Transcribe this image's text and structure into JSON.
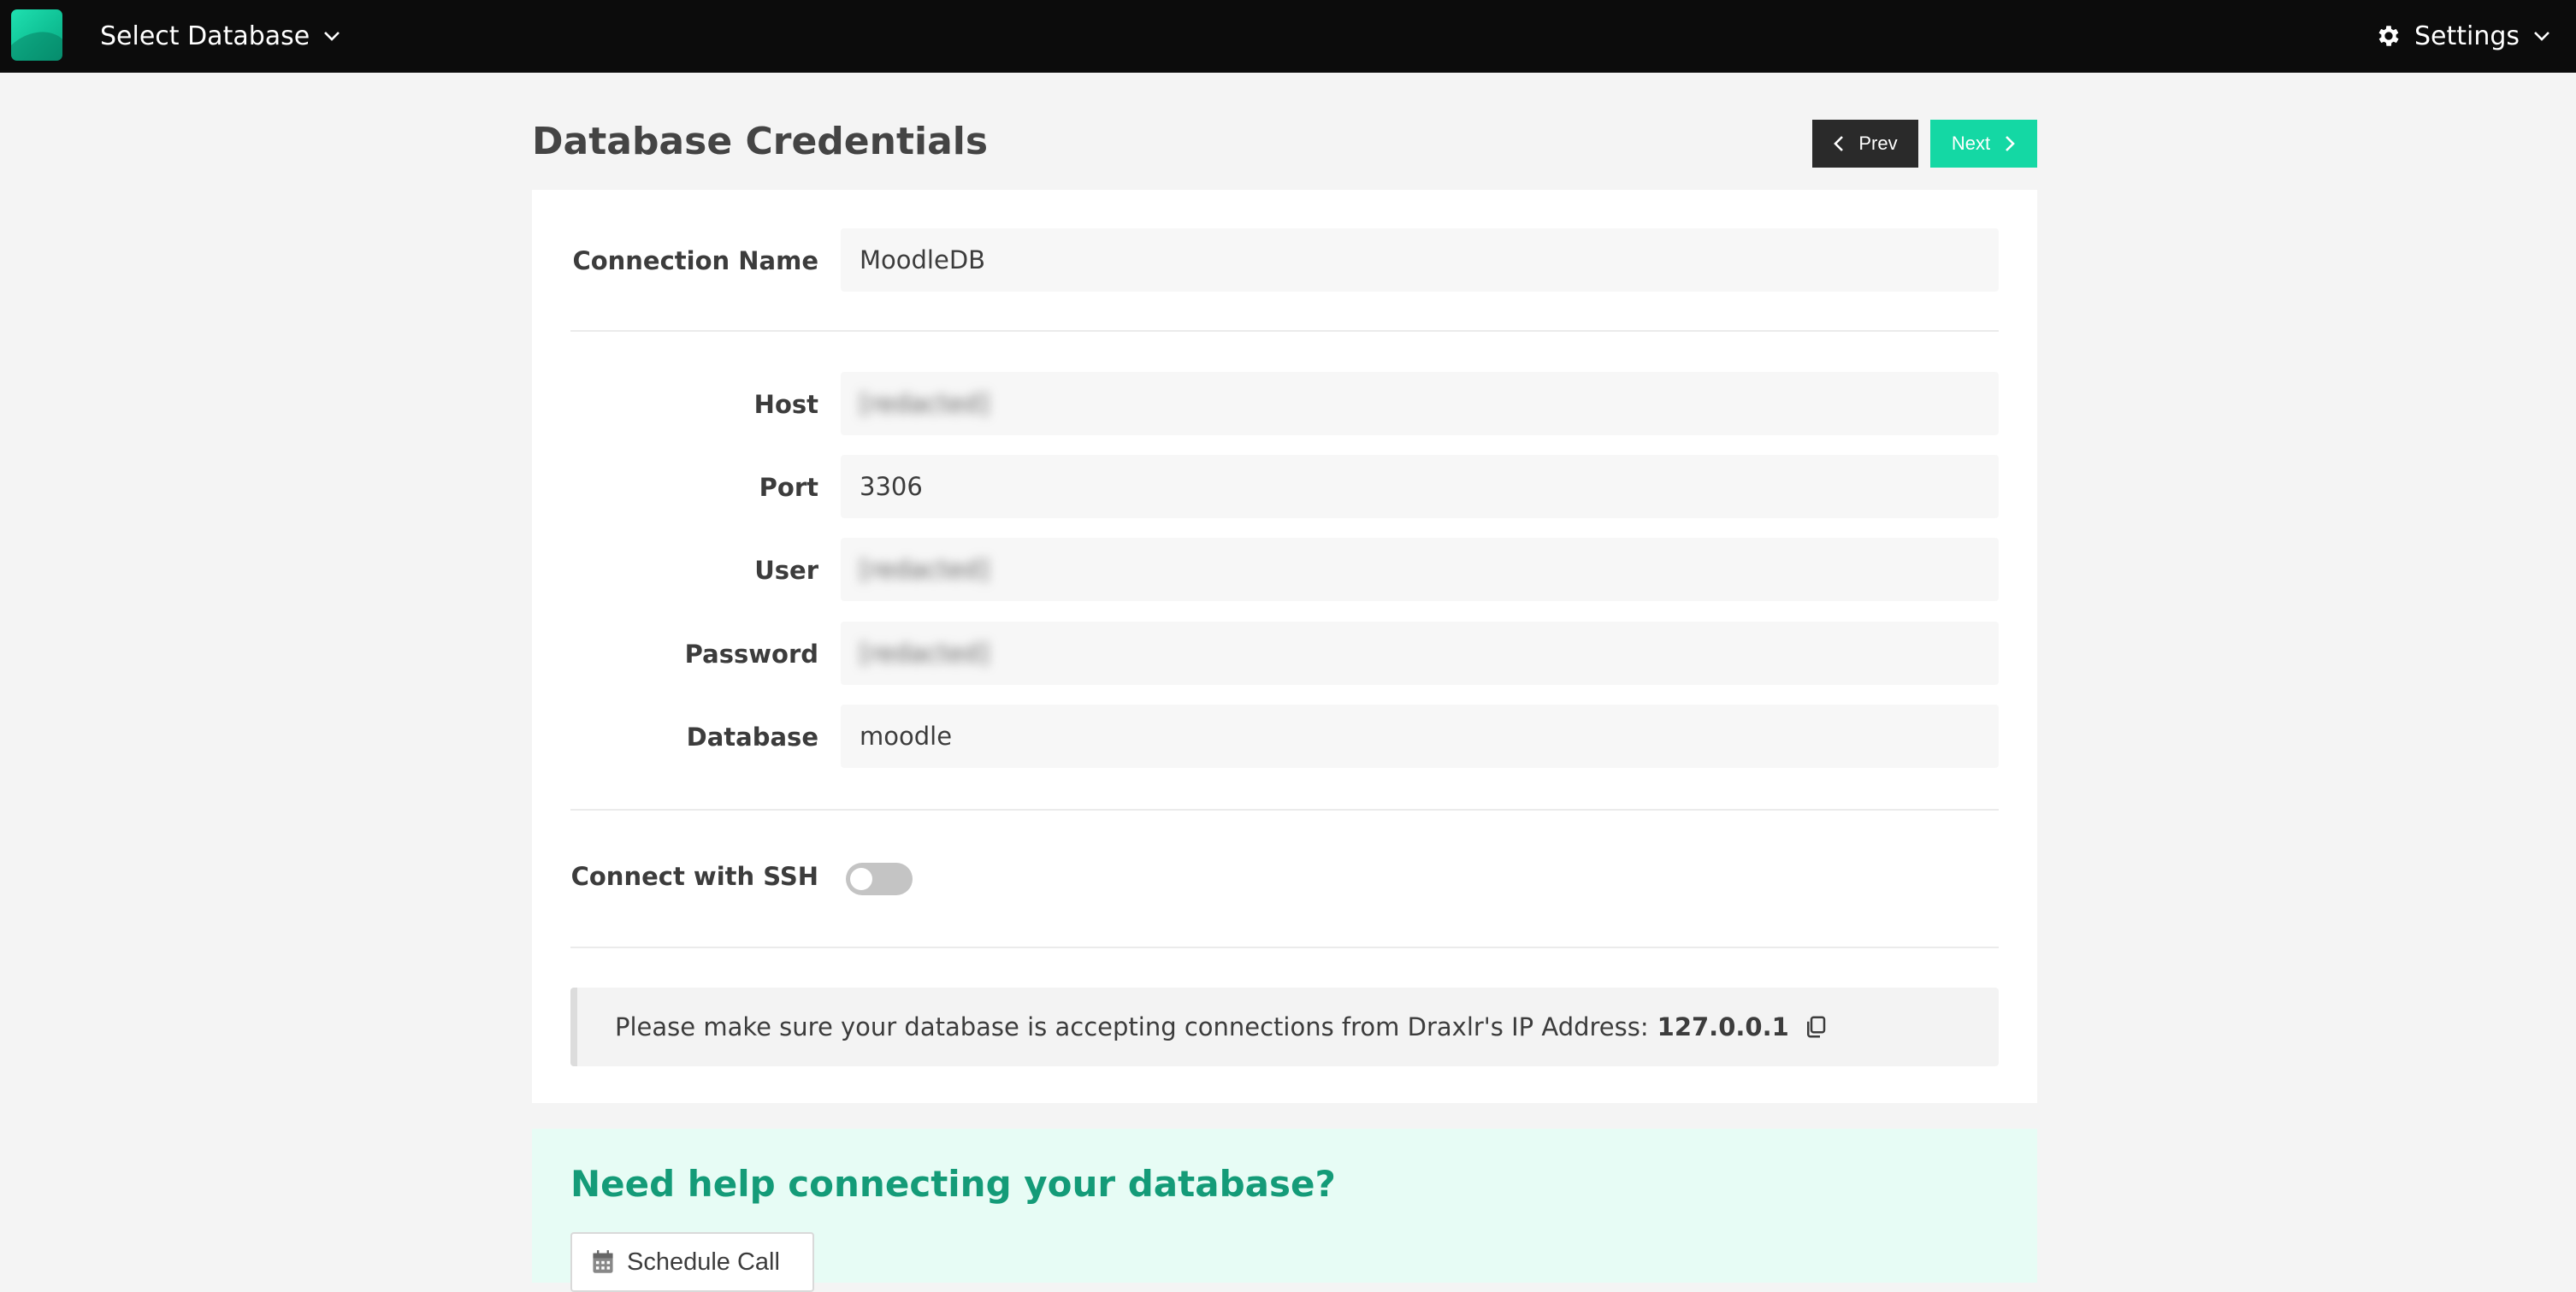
{
  "topbar": {
    "db_select_label": "Select Database",
    "settings_label": "Settings"
  },
  "header": {
    "title": "Database Credentials",
    "prev_label": "Prev",
    "next_label": "Next"
  },
  "form": {
    "connection_name": {
      "label": "Connection Name",
      "value": "MoodleDB"
    },
    "host": {
      "label": "Host",
      "value": "[redacted]"
    },
    "port": {
      "label": "Port",
      "value": "3306"
    },
    "user": {
      "label": "User",
      "value": "[redacted]"
    },
    "password": {
      "label": "Password",
      "value": "[redacted]"
    },
    "database": {
      "label": "Database",
      "value": "moodle"
    },
    "ssh": {
      "label": "Connect with SSH",
      "enabled": false
    }
  },
  "notice": {
    "text": "Please make sure your database is accepting connections from Draxlr's IP Address:",
    "ip": "127.0.0.1"
  },
  "help": {
    "title": "Need help connecting your database?",
    "schedule_label": "Schedule Call"
  },
  "colors": {
    "accent": "#14d8a4",
    "topbar": "#0c0c0c",
    "help_title": "#149b78"
  }
}
